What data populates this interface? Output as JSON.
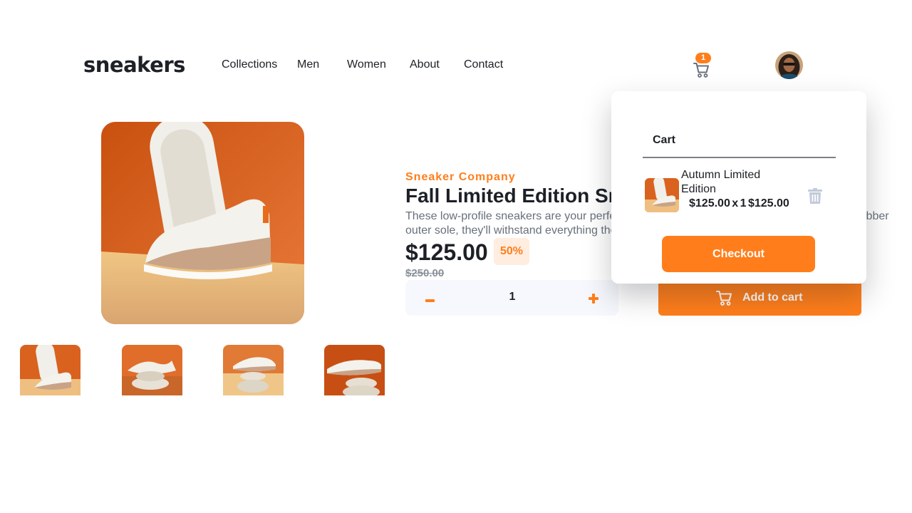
{
  "brand": {
    "logo": "sneakers"
  },
  "nav": {
    "items": [
      "Collections",
      "Men",
      "Women",
      "About",
      "Contact"
    ]
  },
  "header": {
    "cart_icon": "cart-icon",
    "cart_count": "1",
    "avatar": "user-avatar"
  },
  "gallery": {
    "main_image": "product-image-1",
    "thumbnails": [
      "product-thumbnail-1",
      "product-thumbnail-2",
      "product-thumbnail-3",
      "product-thumbnail-4"
    ]
  },
  "product": {
    "company": "Sneaker Company",
    "title": "Fall Limited Edition Sneakers",
    "description": "These low-profile sneakers are your perfect casual wear companion. Featuring a durable rubber outer sole, they'll withstand everything the weather can offer.",
    "price": "$125.00",
    "discount": "50%",
    "original_price": "$250.00",
    "quantity": "1",
    "minus_icon": "minus-icon",
    "plus_icon": "plus-icon",
    "add_to_cart_label": "Add to cart"
  },
  "cart": {
    "heading": "Cart",
    "item": {
      "name": "Autumn Limited Edition",
      "calc": "$125.00 x 1 $125.00"
    },
    "delete_icon": "trash-icon",
    "checkout_label": "Checkout"
  },
  "colors": {
    "accent": "#ff7e1b",
    "accent_light": "#ffede0",
    "text_dark": "#1d2026",
    "text_grey": "#68707d",
    "qty_bg": "#f6f8fd"
  }
}
